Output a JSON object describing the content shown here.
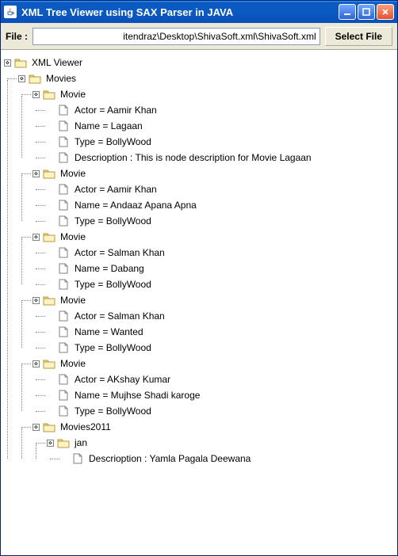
{
  "window": {
    "title": "XML Tree Viewer using SAX Parser in JAVA"
  },
  "toolbar": {
    "file_label": "File :",
    "file_path": "itendraz\\Desktop\\ShivaSoft.xml\\ShivaSoft.xml",
    "select_button": "Select File"
  },
  "icons": {
    "minimize": "minimize-icon",
    "maximize": "maximize-icon",
    "close": "close-icon",
    "java": "java-cup-icon"
  },
  "tree": {
    "root": "XML Viewer",
    "movies_label": "Movies",
    "movie_nodes": [
      {
        "label": "Movie",
        "leaves": [
          "Actor = Aamir Khan",
          "Name = Lagaan",
          "Type = BollyWood",
          "Descrioption : This is node description for Movie Lagaan"
        ]
      },
      {
        "label": "Movie",
        "leaves": [
          "Actor = Aamir Khan",
          "Name = Andaaz Apana Apna",
          "Type = BollyWood"
        ]
      },
      {
        "label": "Movie",
        "leaves": [
          "Actor = Salman Khan",
          "Name = Dabang",
          "Type = BollyWood"
        ]
      },
      {
        "label": "Movie",
        "leaves": [
          "Actor = Salman Khan",
          "Name = Wanted",
          "Type = BollyWood"
        ]
      },
      {
        "label": "Movie",
        "leaves": [
          "Actor = AKshay Kumar",
          "Name = Mujhse Shadi karoge",
          "Type = BollyWood"
        ]
      }
    ],
    "movies2011_label": "Movies2011",
    "jan_label": "jan",
    "jan_leaves": [
      "Descrioption : Yamla Pagala Deewana"
    ]
  }
}
